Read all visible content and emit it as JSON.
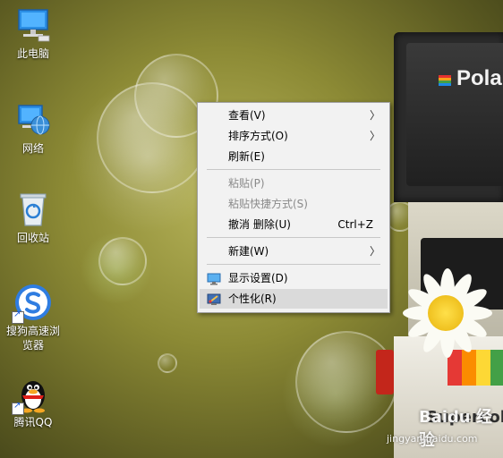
{
  "desktop": {
    "icons": [
      {
        "label": "此电脑"
      },
      {
        "label": "网络"
      },
      {
        "label": "回收站"
      },
      {
        "label": "搜狗高速浏",
        "label2": "览器"
      },
      {
        "label": "腾讯QQ"
      }
    ]
  },
  "wallpaper": {
    "camera_logo": "Pola",
    "camera_text": "Supercol"
  },
  "context_menu": {
    "items": [
      {
        "label": "查看(V)",
        "submenu": true
      },
      {
        "label": "排序方式(O)",
        "submenu": true
      },
      {
        "label": "刷新(E)"
      },
      {
        "label": "粘贴(P)",
        "disabled": true
      },
      {
        "label": "粘贴快捷方式(S)",
        "disabled": true
      },
      {
        "label": "撤消 删除(U)",
        "shortcut": "Ctrl+Z"
      },
      {
        "label": "新建(W)",
        "submenu": true
      },
      {
        "label": "显示设置(D)",
        "icon": "display-settings-icon"
      },
      {
        "label": "个性化(R)",
        "icon": "personalize-icon",
        "highlighted": true
      }
    ],
    "arrow_glyph": "〉"
  },
  "watermark": {
    "logo": "Baidu 经验",
    "url": "jingyan.baidu.com"
  },
  "colors": {
    "menu_bg": "#f2f2f2",
    "menu_highlight": "#dadada",
    "disabled_text": "#8a8a8a"
  }
}
